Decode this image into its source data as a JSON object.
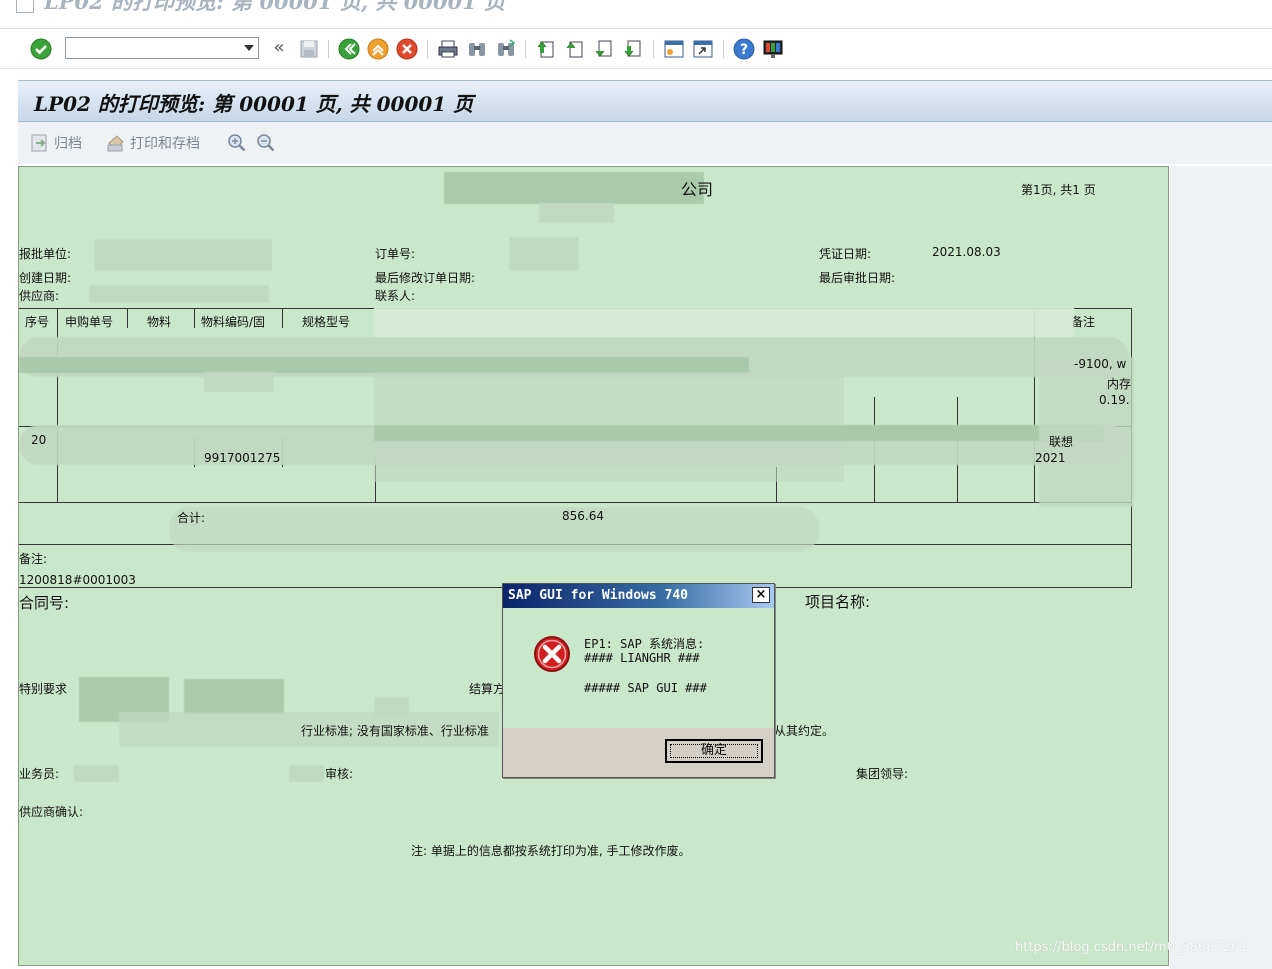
{
  "window": {
    "title": "LP02 的打印预览: 第 00001 页, 共 00001 页"
  },
  "toolbar": {
    "command_value": "",
    "icons": [
      "check-icon",
      "back-double-icon",
      "save-icon",
      "back-icon",
      "exit-icon",
      "cancel-icon",
      "print-icon",
      "find-icon",
      "find-next-icon",
      "first-page-icon",
      "prev-page-icon",
      "next-page-icon",
      "last-page-icon",
      "new-session-icon",
      "shortcut-icon",
      "help-icon",
      "customize-layout-icon"
    ]
  },
  "header": {
    "title": "LP02 的打印预览: 第 00001 页, 共 00001 页"
  },
  "app_toolbar": {
    "archive_label": "归档",
    "print_archive_label": "打印和存档"
  },
  "document": {
    "company_suffix": "公司",
    "page_info": "第1页, 共1 页",
    "fields": {
      "report_unit": "报批单位:",
      "create_date": "创建日期:",
      "supplier": "供应商:",
      "order_no": "订单号:",
      "last_modified": "最后修改订单日期:",
      "contact": "联系人:",
      "voucher_date_label": "凭证日期:",
      "voucher_date": "2021.08.03",
      "last_approval": "最后审批日期:"
    },
    "table_headers": [
      "序号",
      "申购单号",
      "物料",
      "物料编码/固",
      "规格型号",
      "备注"
    ],
    "table_fragments": {
      "row2_seq": "20",
      "row2_code": "9917001275",
      "remark1": "-9100, w",
      "remark2": "内存",
      "remark3": "0.19.",
      "remark4": "联想",
      "remark5": "2021",
      "total_label": "合计:",
      "total_value": "856.64"
    },
    "remarks_label": "备注:",
    "ref_no": "1200818#0001003",
    "contract_no": "合同号:",
    "project_name": "项目名称:",
    "special_req": "特别要求",
    "settlement": "结算方",
    "standards_text": "行业标准; 没有国家标准、行业标准",
    "agreement_text": "从其约定。",
    "salesman": "业务员:",
    "review": "审核:",
    "group_leader": "集团领导:",
    "supplier_confirm": "供应商确认:",
    "note": "注: 单据上的信息都按系统打印为准, 手工修改作废。"
  },
  "dialog": {
    "title": "SAP GUI for Windows 740",
    "close": "×",
    "line1": "EP1: SAP 系统消息:",
    "line2": "#### LIANGHR ###",
    "line3": "##### SAP GUI ###",
    "ok": "确定"
  },
  "watermark": "https://blog.csdn.net/m0_58667261"
}
